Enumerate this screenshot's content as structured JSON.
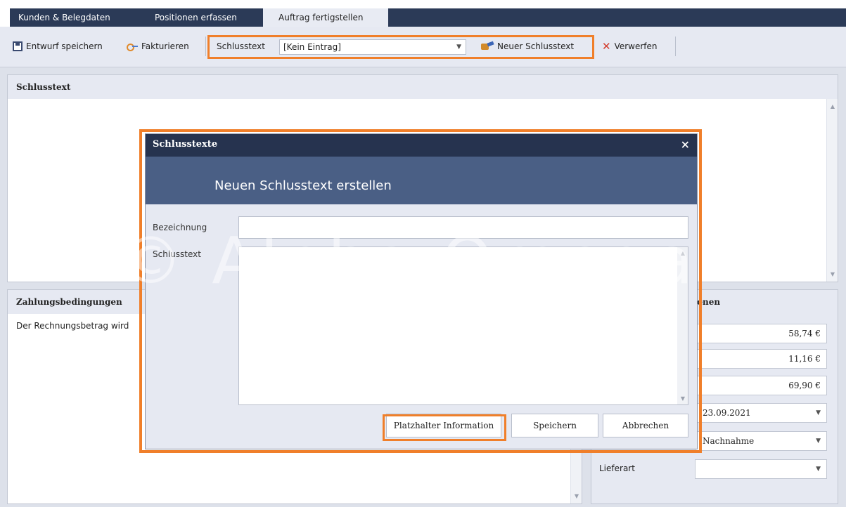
{
  "tabs": [
    {
      "label": "Kunden & Belegdaten"
    },
    {
      "label": "Positionen erfassen"
    },
    {
      "label": "Auftrag fertigstellen"
    }
  ],
  "toolbar": {
    "save_draft": "Entwurf speichern",
    "invoice": "Fakturieren",
    "closing_text_label": "Schlusstext",
    "closing_text_value": "[Kein Eintrag]",
    "new_closing_text": "Neuer Schlusstext",
    "discard": "Verwerfen"
  },
  "panels": {
    "closing_text_title": "Schlusstext",
    "payment_terms_title": "Zahlungsbedingungen",
    "payment_terms_text": "Der Rechnungsbetrag wird",
    "summary_title_partial": "onen"
  },
  "summary": {
    "net": "58,74 €",
    "tax": "11,16 €",
    "gross": "69,90 €",
    "date": "23.09.2021",
    "payment_method": "Nachnahme",
    "shipping_label": "Lieferart",
    "shipping_value": ""
  },
  "dialog": {
    "title": "Schlusstexte",
    "close": "×",
    "heading": "Neuen Schlusstext erstellen",
    "name_label": "Bezeichnung",
    "text_label": "Schlusstext",
    "name_value": "",
    "text_value": "",
    "btn_placeholder_info": "Platzhalter Information",
    "btn_save": "Speichern",
    "btn_cancel": "Abbrechen"
  },
  "watermark": "© Alpha Omega",
  "colors": {
    "highlight": "#f07f2a",
    "tabbar": "#2b3a57",
    "dialog_title": "#26334f",
    "dialog_header": "#4a5f85"
  }
}
